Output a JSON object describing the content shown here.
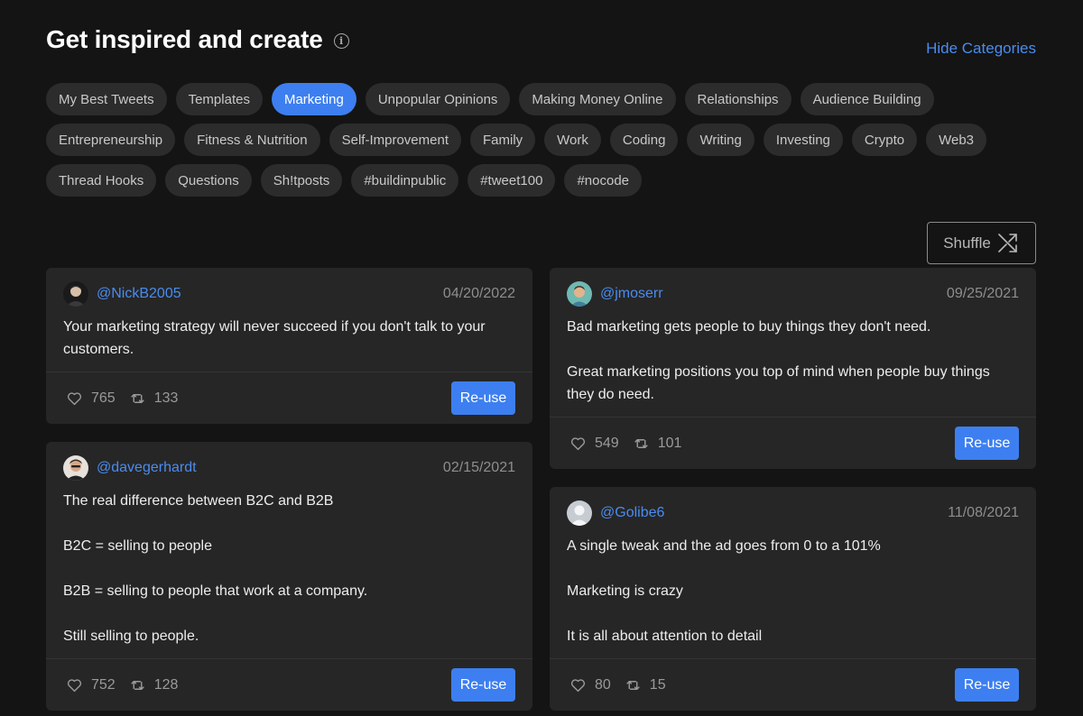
{
  "header": {
    "title": "Get inspired and create",
    "hide_categories": "Hide Categories"
  },
  "categories": [
    {
      "label": "My Best Tweets",
      "active": false
    },
    {
      "label": "Templates",
      "active": false
    },
    {
      "label": "Marketing",
      "active": true
    },
    {
      "label": "Unpopular Opinions",
      "active": false
    },
    {
      "label": "Making Money Online",
      "active": false
    },
    {
      "label": "Relationships",
      "active": false
    },
    {
      "label": "Audience Building",
      "active": false
    },
    {
      "label": "Entrepreneurship",
      "active": false
    },
    {
      "label": "Fitness & Nutrition",
      "active": false
    },
    {
      "label": "Self-Improvement",
      "active": false
    },
    {
      "label": "Family",
      "active": false
    },
    {
      "label": "Work",
      "active": false
    },
    {
      "label": "Coding",
      "active": false
    },
    {
      "label": "Writing",
      "active": false
    },
    {
      "label": "Investing",
      "active": false
    },
    {
      "label": "Crypto",
      "active": false
    },
    {
      "label": "Web3",
      "active": false
    },
    {
      "label": "Thread Hooks",
      "active": false
    },
    {
      "label": "Questions",
      "active": false
    },
    {
      "label": "Sh!tposts",
      "active": false
    },
    {
      "label": "#buildinpublic",
      "active": false
    },
    {
      "label": "#tweet100",
      "active": false
    },
    {
      "label": "#nocode",
      "active": false
    }
  ],
  "shuffle": {
    "label": "Shuffle",
    "icon": "shuffle-icon"
  },
  "tweets": [
    {
      "handle": "@NickB2005",
      "date": "04/20/2022",
      "avatar": "avatar-dark",
      "paragraphs": [
        "Your marketing strategy will never succeed if you don't talk to your customers."
      ],
      "likes": "765",
      "retweets": "133",
      "reuse_label": "Re-use"
    },
    {
      "handle": "@jmoserr",
      "date": "09/25/2021",
      "avatar": "avatar-teal",
      "paragraphs": [
        "Bad marketing gets people to buy things they don't need.",
        "",
        "Great marketing positions you top of mind when people buy things they do need."
      ],
      "likes": "549",
      "retweets": "101",
      "reuse_label": "Re-use"
    },
    {
      "handle": "@davegerhardt",
      "date": "02/15/2021",
      "avatar": "avatar-light",
      "paragraphs": [
        "The real difference between B2C and B2B",
        "",
        "B2C = selling to people",
        "",
        "B2B = selling to people that work at a company.",
        "",
        "Still selling to people."
      ],
      "likes": "752",
      "retweets": "128",
      "reuse_label": "Re-use"
    },
    {
      "handle": "@Golibe6",
      "date": "11/08/2021",
      "avatar": "avatar-default",
      "paragraphs": [
        "A single tweak and the ad goes from 0 to a 101%",
        "",
        "Marketing is crazy",
        "",
        "It is all about attention to detail"
      ],
      "likes": "80",
      "retweets": "15",
      "reuse_label": "Re-use"
    }
  ]
}
